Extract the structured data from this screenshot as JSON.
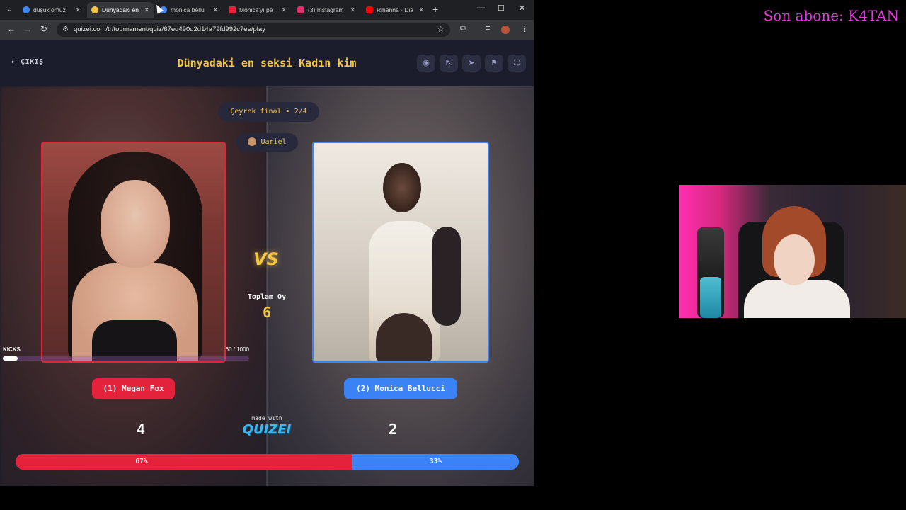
{
  "browser": {
    "tabs": [
      {
        "label": "düşük omuz",
        "favicon_color": "#4285f4",
        "active": false
      },
      {
        "label": "Dünyadaki en",
        "favicon_color": "#f4c542",
        "active": true
      },
      {
        "label": "monica bellu",
        "favicon_color": "#4285f4",
        "active": false
      },
      {
        "label": "Monica'yı pe",
        "favicon_color": "#e5223c",
        "active": false
      },
      {
        "label": "(3) Instagram",
        "favicon_color": "#e1306c",
        "active": false
      },
      {
        "label": "Rihanna - Dia",
        "favicon_color": "#ff0000",
        "active": false
      }
    ],
    "url": "quizei.com/tr/tournament/quiz/67ed490d2d14a79fd992c7ee/play"
  },
  "header": {
    "exit_label": "ÇIKIŞ",
    "title": "Dünyadaki en seksi Kadın kim"
  },
  "round": {
    "label": "Çeyrek final • 2/4"
  },
  "user": {
    "name": "Uariel"
  },
  "vs_label": "VS",
  "total": {
    "label": "Toplam Oy",
    "value": "6"
  },
  "kicks": {
    "label": "KICKS",
    "count_text": "60  / 1000",
    "progress": 0.06
  },
  "contestants": {
    "left": {
      "name": "(1) Megan Fox",
      "votes": "4",
      "percent_text": "67%",
      "percent": 67,
      "color": "#e5223c"
    },
    "right": {
      "name": "(2) Monica Bellucci",
      "votes": "2",
      "percent_text": "33%",
      "percent": 33,
      "color": "#3b82f6"
    }
  },
  "branding": {
    "made_with": "made with",
    "brand": "QUIZEI"
  },
  "stream": {
    "subscriber_text": "Son abone: K4TAN"
  },
  "icons": {
    "header_buttons": [
      "eye-icon",
      "share-icon",
      "send-icon",
      "flag-icon",
      "fullscreen-icon"
    ]
  }
}
